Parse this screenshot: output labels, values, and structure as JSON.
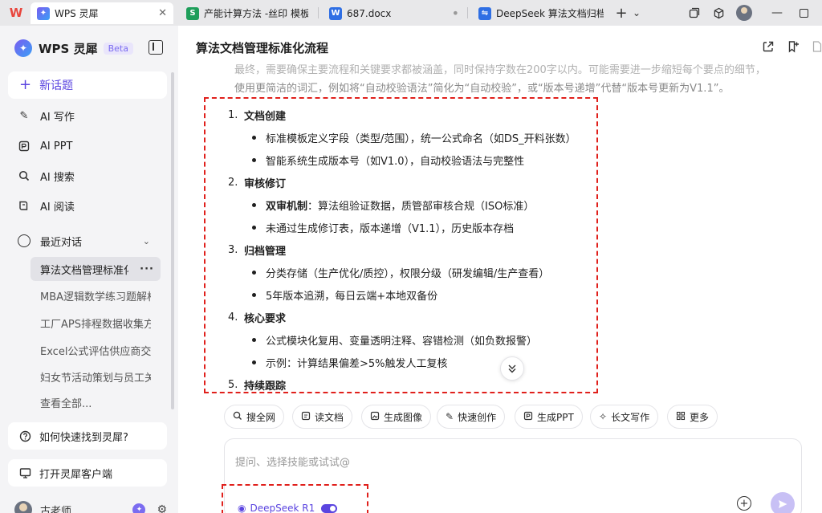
{
  "tabs": [
    {
      "label": "WPS 灵犀",
      "icon": "wps-lingxi-icon",
      "close": "✕"
    },
    {
      "label": "产能计算方法 -丝印 模板.xlsx",
      "icon": "spreadsheet-icon",
      "badge": "S",
      "color": "#1e9e5a"
    },
    {
      "label": "687.docx",
      "icon": "word-doc-icon",
      "badge": "W",
      "color": "#2f6fe4"
    },
    {
      "label": "DeepSeek 算法文档归档流程",
      "icon": "deepseek-doc-icon"
    }
  ],
  "tabbar": {
    "new_tab": "+",
    "new_tab_menu": "⌄",
    "minimize": "—"
  },
  "sidebar": {
    "brand": "WPS 灵犀",
    "beta": "Beta",
    "new_chat": "新话题",
    "nav": [
      {
        "label": "AI 写作",
        "icon": "pen-icon"
      },
      {
        "label": "AI PPT",
        "icon": "ppt-icon"
      },
      {
        "label": "AI 搜索",
        "icon": "search-icon"
      },
      {
        "label": "AI 阅读",
        "icon": "book-icon"
      }
    ],
    "recent_title": "最近对话",
    "recent": [
      "算法文档管理标准化流程",
      "MBA逻辑数学练习题解析",
      "工厂APS排程数据收集方案",
      "Excel公式评估供应商交付",
      "妇女节活动策划与员工关怀"
    ],
    "recent_more": "···",
    "see_all": "查看全部...",
    "help": "如何快速找到灵犀?",
    "open_client": "打开灵犀客户端",
    "user_name": "古老师"
  },
  "main": {
    "title": "算法文档管理标准化流程",
    "thinking_line1": "最终，需要确保主要流程和关键要求都被涵盖，同时保持字数在200字以内。可能需要进一步缩短每个要点的细节，",
    "thinking_line2": "使用更简洁的词汇，例如将“自动校验语法”简化为“自动校验”，或“版本号递增”代替“版本号更新为V1.1”。",
    "sections": [
      {
        "num": "1.",
        "title": "文档创建",
        "bullets": [
          {
            "bold": "",
            "text": "标准模板定义字段（类型/范围），统一公式命名（如DS_开料张数）"
          },
          {
            "bold": "",
            "text": "智能系统生成版本号（如V1.0），自动校验语法与完整性"
          }
        ]
      },
      {
        "num": "2.",
        "title": "审核修订",
        "bullets": [
          {
            "bold": "双审机制",
            "text": "：算法组验证数据，质管部审核合规（ISO标准）"
          },
          {
            "bold": "",
            "text": "未通过生成修订表，版本递增（V1.1），历史版本存档"
          }
        ]
      },
      {
        "num": "3.",
        "title": "归档管理",
        "bullets": [
          {
            "bold": "",
            "text": "分类存储（生产优化/质控），权限分级（研发编辑/生产查看）"
          },
          {
            "bold": "",
            "text": "5年版本追溯，每日云端+本地双备份"
          }
        ]
      },
      {
        "num": "4.",
        "title": "核心要求",
        "bullets": [
          {
            "bold": "",
            "text": "公式模块化复用、变量透明注释、容错检测（如负数报警）"
          },
          {
            "bold": "",
            "text": "示例：计算结果偏差>5%触发人工复核"
          }
        ]
      },
      {
        "num": "5.",
        "title": "持续跟踪",
        "bullets": []
      }
    ],
    "chips": [
      {
        "label": "搜全网",
        "icon": "web-search-icon"
      },
      {
        "label": "读文档",
        "icon": "read-doc-icon"
      },
      {
        "label": "生成图像",
        "icon": "image-gen-icon"
      },
      {
        "label": "快速创作",
        "icon": "quick-create-icon"
      },
      {
        "label": "生成PPT",
        "icon": "ppt-gen-icon"
      },
      {
        "label": "长文写作",
        "icon": "long-write-icon"
      },
      {
        "label": "更多",
        "icon": "more-grid-icon"
      }
    ],
    "input_placeholder": "提问、选择技能或试试@",
    "model_label": "DeepSeek R1"
  },
  "colors": {
    "accent": "#5b45e0",
    "highlight_border": "#e0201c",
    "sidebar_bg": "#f4f4f6",
    "tabbar_bg": "#e8e8ea"
  }
}
